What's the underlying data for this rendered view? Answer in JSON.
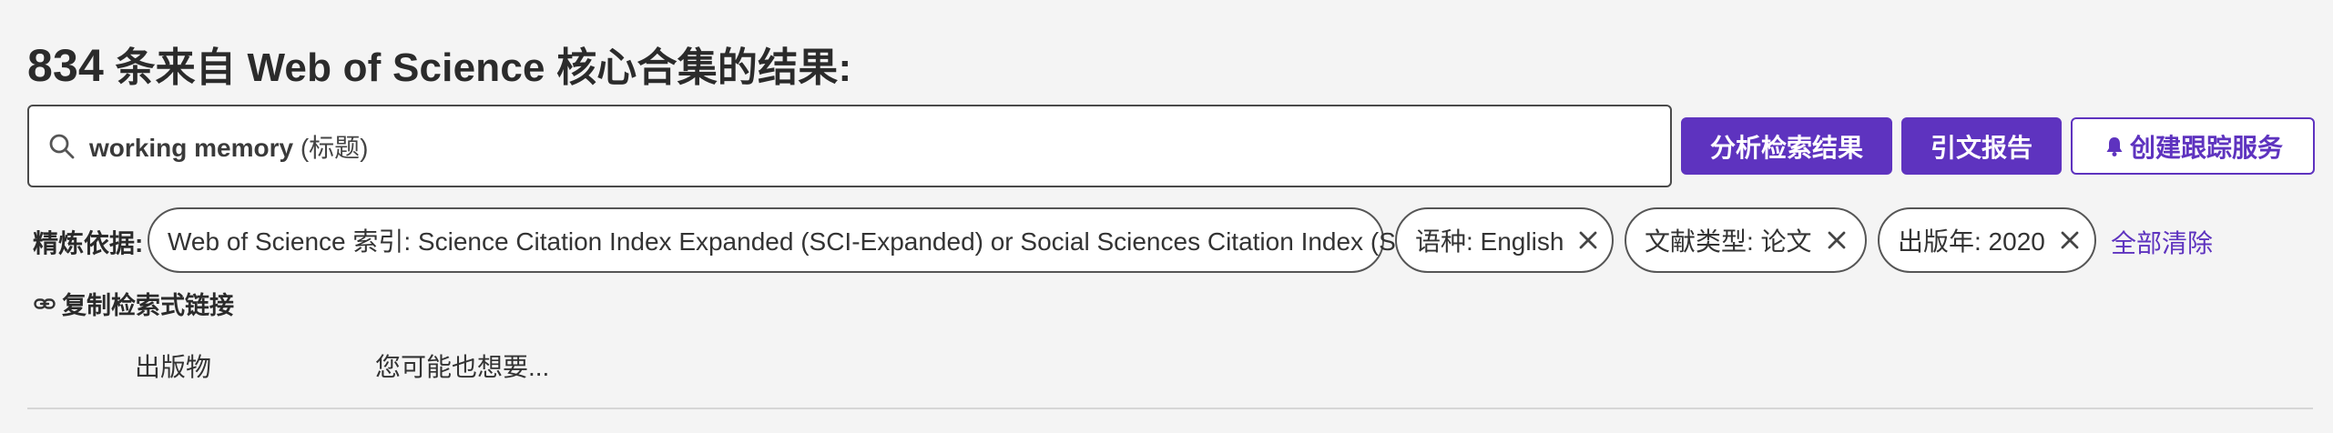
{
  "header": {
    "result_count": "834",
    "result_text": " 条来自 Web of Science 核心合集的结果:"
  },
  "search": {
    "term": "working memory",
    "field": " (标题)",
    "icon": "search-icon"
  },
  "actions": {
    "analyze_label": "分析检索结果",
    "citation_report_label": "引文报告",
    "create_alert_label": "创建跟踪服务",
    "accent_color": "#5e33bf"
  },
  "refine": {
    "label": "精炼依据:",
    "chips": [
      {
        "label": "Web of Science 索引: Science Citation Index Expanded (SCI-Expanded) or Social Sciences Citation Index (SSCI)"
      },
      {
        "label": "语种: English"
      },
      {
        "label": "文献类型: 论文"
      },
      {
        "label": "出版年: 2020"
      }
    ],
    "clear_all_label": "全部清除"
  },
  "copy_query_link": {
    "label": "复制检索式链接",
    "icon": "link-icon"
  },
  "tabs": [
    {
      "label": "出版物"
    },
    {
      "label": "您可能也想要..."
    }
  ]
}
